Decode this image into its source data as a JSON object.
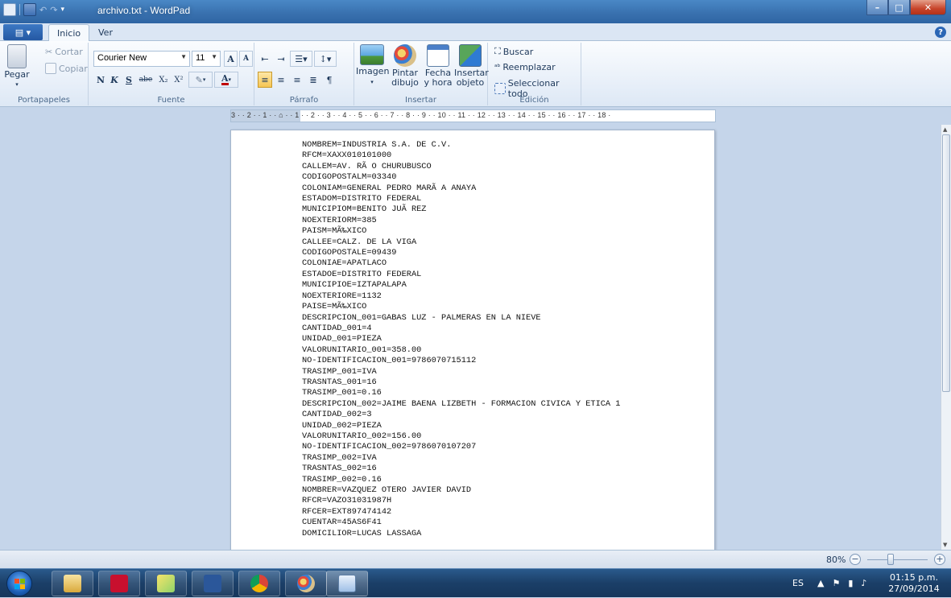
{
  "window": {
    "title": "archivo.txt - WordPad",
    "min_label": "–",
    "max_label": "□",
    "close_label": "✕"
  },
  "tabs": {
    "app_menu": "▤ ▾",
    "inicio": "Inicio",
    "ver": "Ver",
    "help": "?"
  },
  "ribbon": {
    "portapapeles": {
      "label": "Portapapeles",
      "pegar": "Pegar",
      "cortar": "Cortar",
      "copiar": "Copiar"
    },
    "fuente": {
      "label": "Fuente",
      "font_family": "Courier New",
      "font_size": "11",
      "grow": "A",
      "shrink": "A",
      "bold": "N",
      "italic": "K",
      "underline": "S",
      "strike": "abe",
      "subscript": "X₂",
      "superscript": "X²"
    },
    "parrafo": {
      "label": "Párrafo"
    },
    "insertar": {
      "label": "Insertar",
      "imagen": "Imagen",
      "pintar": "Pintar dibujo",
      "fecha": "Fecha y hora",
      "objeto": "Insertar objeto"
    },
    "edicion": {
      "label": "Edición",
      "buscar": "Buscar",
      "reemplazar": "Reemplazar",
      "seleccionar": "Seleccionar todo"
    }
  },
  "ruler": {
    "text": "3 · · 2 · · 1 · · ⌂ · · 1 · · 2 · · 3 · · 4 · · 5 · · 6 · · 7 · · 8 · · 9 · · 10 · · 11 · · 12 · · 13 · · 14 · · 15 · · 16 · · 17 · · 18 ·"
  },
  "document": {
    "lines": [
      "NOMBREM=INDUSTRIA S.A. DE C.V.",
      "RFCM=XAXX010101000",
      "CALLEM=AV. RÃ O CHURUBUSCO",
      "CODIGOPOSTALM=03340",
      "COLONIAM=GENERAL PEDRO MARÃ A ANAYA",
      "ESTADOM=DISTRITO FEDERAL",
      "MUNICIPIOM=BENITO JUÃ REZ",
      "NOEXTERIORM=385",
      "PAISM=MÃ‰XICO",
      "CALLEE=CALZ. DE LA VIGA",
      "CODIGOPOSTALE=09439",
      "COLONIAE=APATLACO",
      "ESTADOE=DISTRITO FEDERAL",
      "MUNICIPIOE=IZTAPALAPA",
      "NOEXTERIORE=1132",
      "PAISE=MÃ‰XICO",
      "DESCRIPCION_001=GABAS LUZ - PALMERAS EN LA NIEVE",
      "CANTIDAD_001=4",
      "UNIDAD_001=PIEZA",
      "VALORUNITARIO_001=358.00",
      "NO-IDENTIFICACION_001=9786070715112",
      "TRASIMP_001=IVA",
      "TRASNTAS_001=16",
      "TRASIMP_001=0.16",
      "DESCRIPCION_002=JAIME BAENA LIZBETH - FORMACION CIVICA Y ETICA 1",
      "CANTIDAD_002=3",
      "UNIDAD_002=PIEZA",
      "VALORUNITARIO_002=156.00",
      "NO-IDENTIFICACION_002=9786070107207",
      "TRASIMP_002=IVA",
      "TRASNTAS_002=16",
      "TRASIMP_002=0.16",
      "NOMBRER=VAZQUEZ OTERO JAVIER DAVID",
      "RFCR=VAZO31031987H",
      "RFCER=EXT897474142",
      "CUENTAR=45AS6F41",
      "DOMICILIOR=LUCAS LASSAGA"
    ]
  },
  "status": {
    "zoom": "80%",
    "zoom_out": "−",
    "zoom_in": "+"
  },
  "taskbar": {
    "language": "ES",
    "tray_arrow": "▲",
    "time": "01:15 p.m.",
    "date": "27/09/2014"
  }
}
